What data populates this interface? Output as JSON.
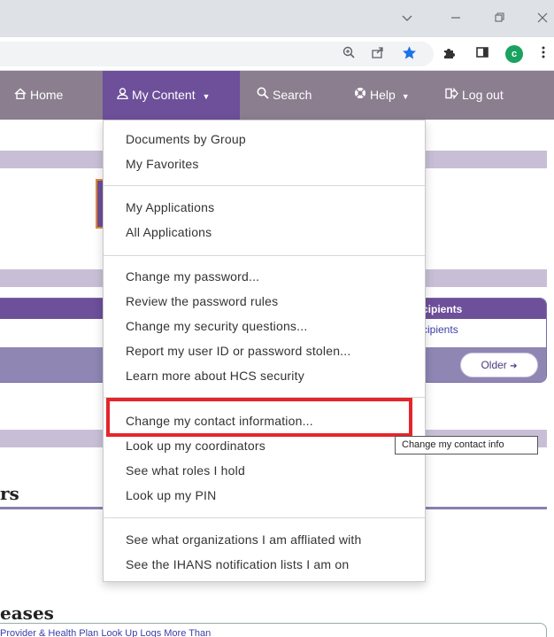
{
  "browser": {
    "profile_initial": "c",
    "icons": {
      "minimize": "chevron-down-icon",
      "zoom": "zoom-icon",
      "share": "share-icon",
      "bookmark": "star-icon",
      "extensions": "puzzle-icon",
      "sidepanel": "side-panel-icon",
      "menu": "kebab-menu-icon"
    }
  },
  "nav": {
    "home": "Home",
    "my_content": "My Content",
    "search": "Search",
    "help": "Help",
    "logout": "Log out"
  },
  "page": {
    "panel_header": "cipients",
    "panel_link": "cipients",
    "older_button": "Older",
    "heading_rs": "rs",
    "heading_eases": "eases",
    "release_snippet": "Provider & Health Plan Look Up Logs More Than"
  },
  "dropdown": {
    "groups": [
      [
        "Documents by Group",
        "My Favorites"
      ],
      [
        "My Applications",
        "All Applications"
      ],
      [
        "Change my password...",
        "Review the password rules",
        "Change my security questions...",
        "Report my user ID or password stolen...",
        "Learn more about HCS security"
      ],
      [
        "Change my contact information...",
        "Look up my coordinators",
        "See what roles I hold",
        "Look up my PIN"
      ],
      [
        "See what organizations I am affliated with",
        "See the IHANS notification lists I am on"
      ]
    ]
  },
  "tooltip": "Change my contact info",
  "colors": {
    "nav_bg": "#8a7e8f",
    "nav_active": "#6d4f9a",
    "highlight": "#e3262c",
    "band": "#c8bfd6"
  }
}
